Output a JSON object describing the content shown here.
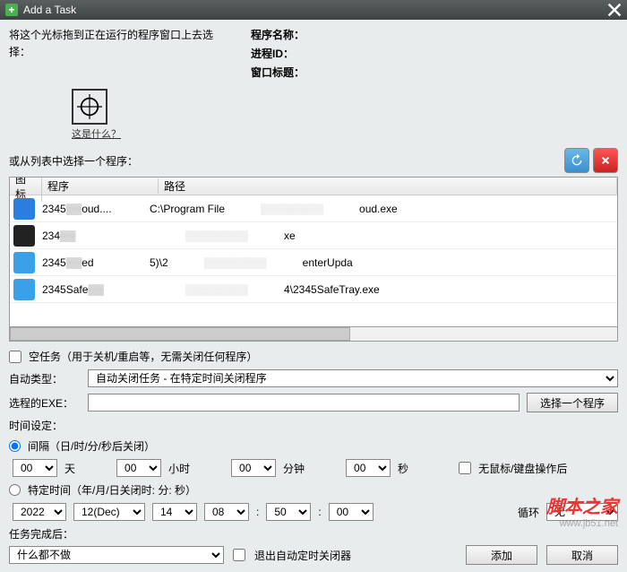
{
  "title": "Add a Task",
  "instruction": "将这个光标拖到正在运行的程序窗口上去选择：",
  "info": {
    "name": "程序名称：",
    "pid": "进程ID：",
    "wtitle": "窗口标题："
  },
  "whatlink": "这是什么？",
  "listhead": "或从列表中选择一个程序：",
  "cols": {
    "icon": "图标",
    "prog": "程序",
    "path": "路径"
  },
  "rows": [
    {
      "color": "#2b7de0",
      "prog": "2345",
      "prog2": "oud....",
      "path": "C:\\Program File",
      "path2": "oud.exe"
    },
    {
      "color": "#222",
      "prog": "234",
      "prog2": "",
      "path": "",
      "path2": "xe"
    },
    {
      "color": "#3aa0e8",
      "prog": "2345",
      "prog2": "ed",
      "path": "5)\\2",
      "path2": "enterUpda"
    },
    {
      "color": "#3aa0e8",
      "prog": "2345Safe",
      "prog2": "",
      "path": "",
      "path2": "4\\2345SafeTray.exe"
    }
  ],
  "emptytask": "空任务（用于关机/重启等，无需关闭任何程序）",
  "autotype_label": "自动类型：",
  "autotype_value": "自动关闭任务 - 在特定时间关闭程序",
  "exe_label": "选程的EXE：",
  "choose_btn": "选择一个程序",
  "timeset": "时间设定：",
  "interval_label": "间隔（日/时/分/秒后关闭）",
  "units": {
    "day": "天",
    "hour": "小时",
    "min": "分钟",
    "sec": "秒"
  },
  "vals": {
    "d": "00",
    "h": "00",
    "m": "00",
    "s": "00"
  },
  "noinput": "无鼠标/键盘操作后",
  "specific_label": "特定时间（年/月/日关闭时: 分: 秒）",
  "spec": {
    "year": "2022",
    "month": "12(Dec)",
    "day": "14",
    "hour": "08",
    "min": "50",
    "sec": "00"
  },
  "loop_label": "循环",
  "loop_value": "无",
  "after_label": "任务完成后：",
  "after_value": "什么都不做",
  "exit_chk": "退出自动定时关闭器",
  "add_btn": "添加",
  "cancel_btn": "取消",
  "watermark": {
    "cn": "脚本之家",
    "url": "www.jb51.net"
  }
}
